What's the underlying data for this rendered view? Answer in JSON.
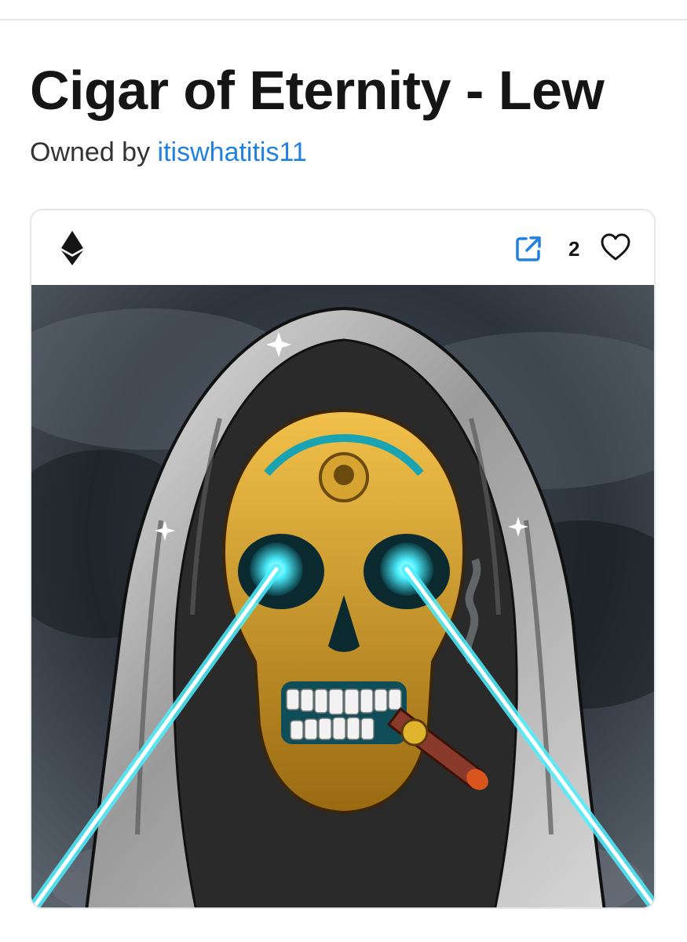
{
  "item": {
    "title": "Cigar of Eternity - Lew",
    "owned_by_prefix": "Owned by",
    "owner_name": "itiswhatitis11"
  },
  "card": {
    "chain_icon": "ethereum-icon",
    "external_link_icon": "external-link-icon",
    "favorites_count": "2",
    "favorite_icon": "heart-outline-icon"
  },
  "artwork": {
    "description_icon": "hooded-skull-with-laser-eyes-and-cigar"
  },
  "colors": {
    "link": "#2081e2",
    "laser": "#4df0ff",
    "gold": "#c9951f",
    "border": "#e5e8eb"
  }
}
